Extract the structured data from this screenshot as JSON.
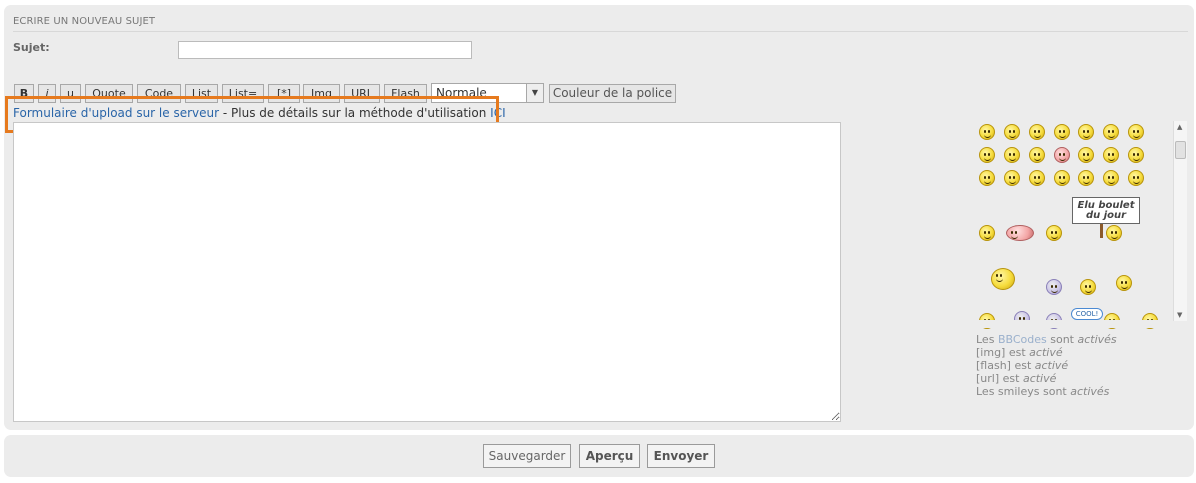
{
  "form": {
    "title": "ECRIRE UN NOUVEAU SUJET",
    "subject_label": "Sujet:",
    "subject_value": ""
  },
  "toolbar": {
    "bold": "B",
    "italic": "i",
    "underline": "u",
    "quote": "Quote",
    "code": "Code",
    "list": "List",
    "list_ordered": "List=",
    "list_item": "[*]",
    "img": "Img",
    "url": "URL",
    "flash": "Flash",
    "font_size_selected": "Normale",
    "font_color": "Couleur de la police"
  },
  "upload": {
    "link_text": "Formulaire d'upload sur le serveur",
    "separator": " - Plus de détails sur la méthode d'utilisation ",
    "ici": "ICI"
  },
  "message": {
    "value": ""
  },
  "smileys": {
    "sign_text_line1": "Elu boulet",
    "sign_text_line2": "du jour",
    "cool_text": "COOL!"
  },
  "bbinfo": {
    "line1_a": "Les ",
    "line1_link": "BBCodes",
    "line1_b": " sont ",
    "line1_c": "activés",
    "line2_a": "[img] est ",
    "line2_b": "activé",
    "line3_a": "[flash] est ",
    "line3_b": "activé",
    "line4_a": "[url] est ",
    "line4_b": "activé",
    "line5_a": "Les smileys sont ",
    "line5_b": "activés"
  },
  "footer": {
    "save": "Sauvegarder",
    "preview": "Aperçu",
    "send": "Envoyer"
  },
  "colors": {
    "highlight": "#e67a1e",
    "link": "#2a65a8",
    "panel": "#ececec"
  }
}
